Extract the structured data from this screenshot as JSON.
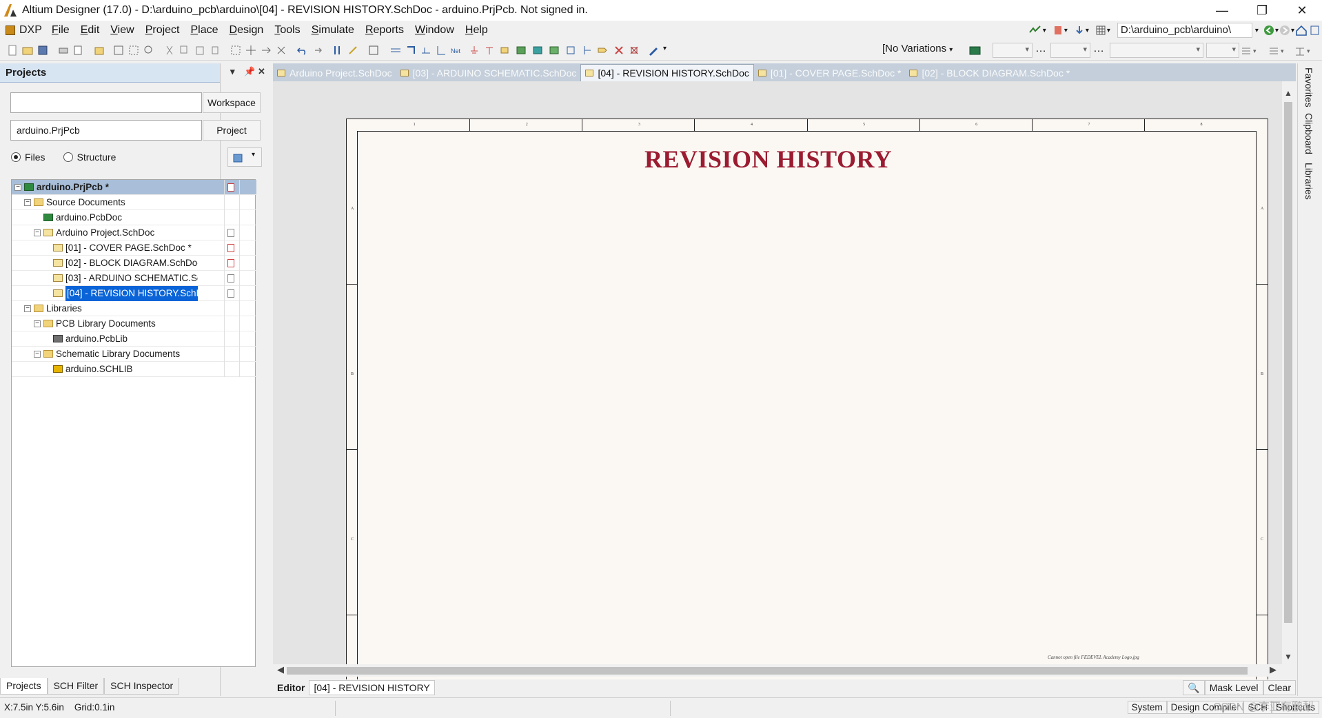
{
  "window": {
    "title": "Altium Designer (17.0) - D:\\arduino_pcb\\arduino\\[04] - REVISION HISTORY.SchDoc - arduino.PrjPcb. Not signed in.",
    "controls": [
      "—",
      "❐",
      "✕"
    ]
  },
  "menu": {
    "items": [
      "DXP",
      "File",
      "Edit",
      "View",
      "Project",
      "Place",
      "Design",
      "Tools",
      "Simulate",
      "Reports",
      "Window",
      "Help"
    ]
  },
  "toolbar": {
    "path_combo": "D:\\arduino_pcb\\arduino\\",
    "variations": "[No Variations"
  },
  "projects_panel": {
    "title": "Projects",
    "workspace_value": "",
    "workspace_button": "Workspace",
    "project_value": "arduino.PrjPcb",
    "project_button": "Project",
    "radio_files": "Files",
    "radio_structure": "Structure",
    "tree": [
      {
        "label": "arduino.PrjPcb *",
        "level": 0,
        "icon": "project-icon",
        "expand": "−",
        "modified": true,
        "bold": true,
        "selected_light": true
      },
      {
        "label": "Source Documents",
        "level": 1,
        "icon": "folder-icon",
        "expand": "−"
      },
      {
        "label": "arduino.PcbDoc",
        "level": 2,
        "icon": "pcbdoc-icon",
        "expand": ""
      },
      {
        "label": "Arduino Project.SchDoc",
        "level": 2,
        "icon": "schdoc-icon",
        "expand": "−",
        "state": true
      },
      {
        "label": "[01] - COVER PAGE.SchDoc *",
        "level": 3,
        "icon": "schdoc-icon",
        "expand": "",
        "modified": true
      },
      {
        "label": "[02] - BLOCK DIAGRAM.SchDoc *",
        "level": 3,
        "icon": "schdoc-icon",
        "expand": "",
        "modified": true
      },
      {
        "label": "[03] - ARDUINO SCHEMATIC.SchDoc",
        "level": 3,
        "icon": "schdoc-icon",
        "expand": "",
        "state": true
      },
      {
        "label": "[04] - REVISION HISTORY.SchDoc",
        "level": 3,
        "icon": "schdoc-icon",
        "expand": "",
        "state": true,
        "selected": true
      },
      {
        "label": "Libraries",
        "level": 1,
        "icon": "folder-icon",
        "expand": "−"
      },
      {
        "label": "PCB Library Documents",
        "level": 2,
        "icon": "folder-icon",
        "expand": "−"
      },
      {
        "label": "arduino.PcbLib",
        "level": 3,
        "icon": "pcblib-icon",
        "expand": ""
      },
      {
        "label": "Schematic Library Documents",
        "level": 2,
        "icon": "folder-icon",
        "expand": "−"
      },
      {
        "label": "arduino.SCHLIB",
        "level": 3,
        "icon": "schlib-icon",
        "expand": ""
      }
    ],
    "bottom_tabs": [
      "Projects",
      "SCH Filter",
      "SCH Inspector"
    ]
  },
  "doc_tabs": [
    {
      "label": "Arduino Project.SchDoc",
      "active": false
    },
    {
      "label": "[03] - ARDUINO SCHEMATIC.SchDoc",
      "active": false
    },
    {
      "label": "[04] - REVISION HISTORY.SchDoc",
      "active": true
    },
    {
      "label": "[01] - COVER PAGE.SchDoc *",
      "active": false
    },
    {
      "label": "[02] - BLOCK DIAGRAM.SchDoc *",
      "active": false
    }
  ],
  "sheet": {
    "title": "REVISION HISTORY",
    "footnote": "Cannot open file FEDEVEL Academy Logo.jpg",
    "col_marks": [
      "1",
      "2",
      "3",
      "4",
      "5",
      "6",
      "7",
      "8"
    ],
    "row_marks": [
      "A",
      "B",
      "C"
    ]
  },
  "right_panels": [
    "Favorites",
    "Clipboard",
    "Libraries"
  ],
  "editor_bar": {
    "label": "Editor",
    "doc": "[04] - REVISION HISTORY",
    "mask_level": "Mask Level",
    "clear": "Clear"
  },
  "status": {
    "coords": "X:7.5in Y:5.6in",
    "grid": "Grid:0.1in",
    "right": [
      "System",
      "Design Compiler",
      "SCH",
      "Shortcuts"
    ],
    "watermark": "CSDN @李亚有鹏梨"
  }
}
